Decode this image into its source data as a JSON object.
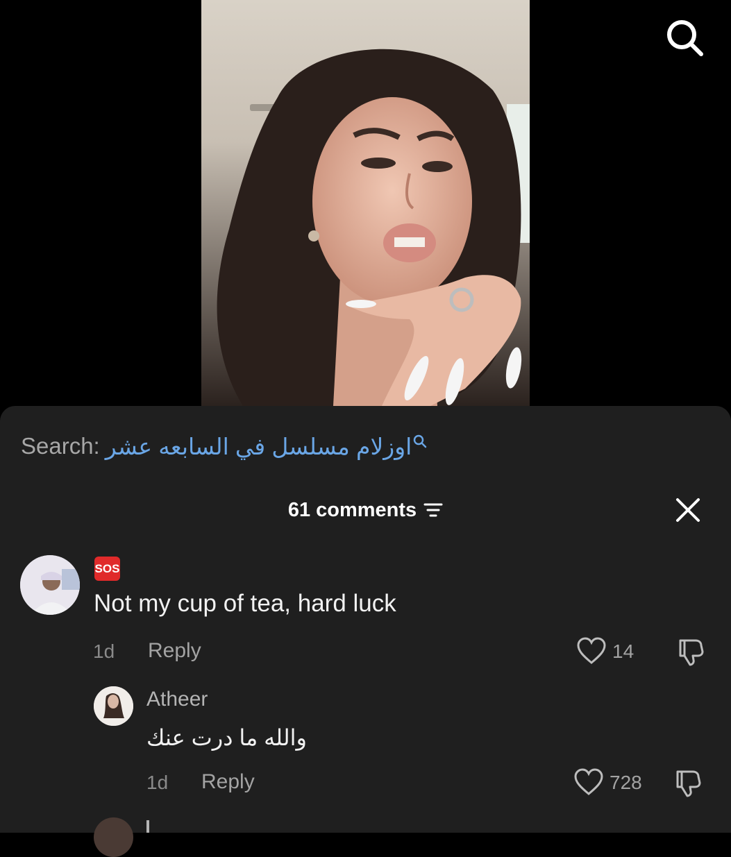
{
  "top_bar": {
    "search_icon": "search-icon"
  },
  "search": {
    "prefix": "Search:",
    "term": "اوزلام مسلسل في السابعه عشر"
  },
  "comments_header": {
    "count_label": "61 comments",
    "filter_icon": "filter-icon",
    "close_icon": "close-icon"
  },
  "comments": [
    {
      "badge": "SOS",
      "text": "Not my cup of tea, hard luck",
      "time": "1d",
      "reply_label": "Reply",
      "likes": "14"
    }
  ],
  "replies": [
    {
      "username": "Atheer",
      "text": "والله ما درت عنك",
      "time": "1d",
      "reply_label": "Reply",
      "likes": "728"
    }
  ],
  "colors": {
    "sheet_bg": "#1f1f1f",
    "search_term": "#6aa6e6",
    "badge": "#e02a2a"
  }
}
